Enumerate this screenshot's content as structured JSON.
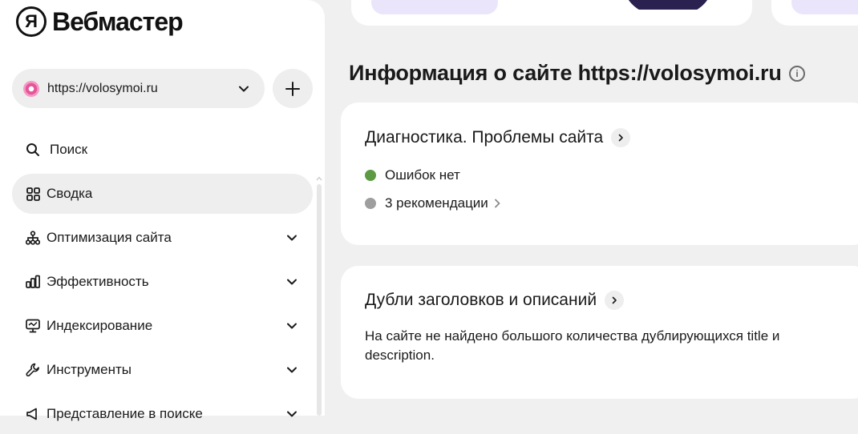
{
  "brand": {
    "logo_letter": "Я",
    "name": "Вебмастер"
  },
  "site_selector": {
    "url": "https://volosymoi.ru",
    "favicon": "site-favicon"
  },
  "add_site": {
    "label": "+"
  },
  "sidebar": {
    "items": [
      {
        "label": "Поиск",
        "icon": "search-icon",
        "expandable": false,
        "active": false
      },
      {
        "label": "Сводка",
        "icon": "dashboard-icon",
        "expandable": false,
        "active": true
      },
      {
        "label": "Оптимизация сайта",
        "icon": "sitemap-icon",
        "expandable": true,
        "active": false
      },
      {
        "label": "Эффективность",
        "icon": "bar-chart-icon",
        "expandable": true,
        "active": false
      },
      {
        "label": "Индексирование",
        "icon": "monitor-icon",
        "expandable": true,
        "active": false
      },
      {
        "label": "Инструменты",
        "icon": "wrench-icon",
        "expandable": true,
        "active": false
      },
      {
        "label": "Представление в поиске",
        "icon": "megaphone-icon",
        "expandable": true,
        "active": false
      }
    ]
  },
  "main": {
    "title": "Информация о сайте https://volosymoi.ru",
    "diagnostics": {
      "title": "Диагностика. Проблемы сайта",
      "statuses": [
        {
          "label": "Ошибок нет",
          "color": "#5c9a44",
          "link": false
        },
        {
          "label": "3 рекомендации",
          "color": "#9e9e9e",
          "link": true
        }
      ]
    },
    "duplicates": {
      "title": "Дубли заголовков и описаний",
      "text": "На сайте не найдено большого количества дублирующихся title и description."
    }
  }
}
